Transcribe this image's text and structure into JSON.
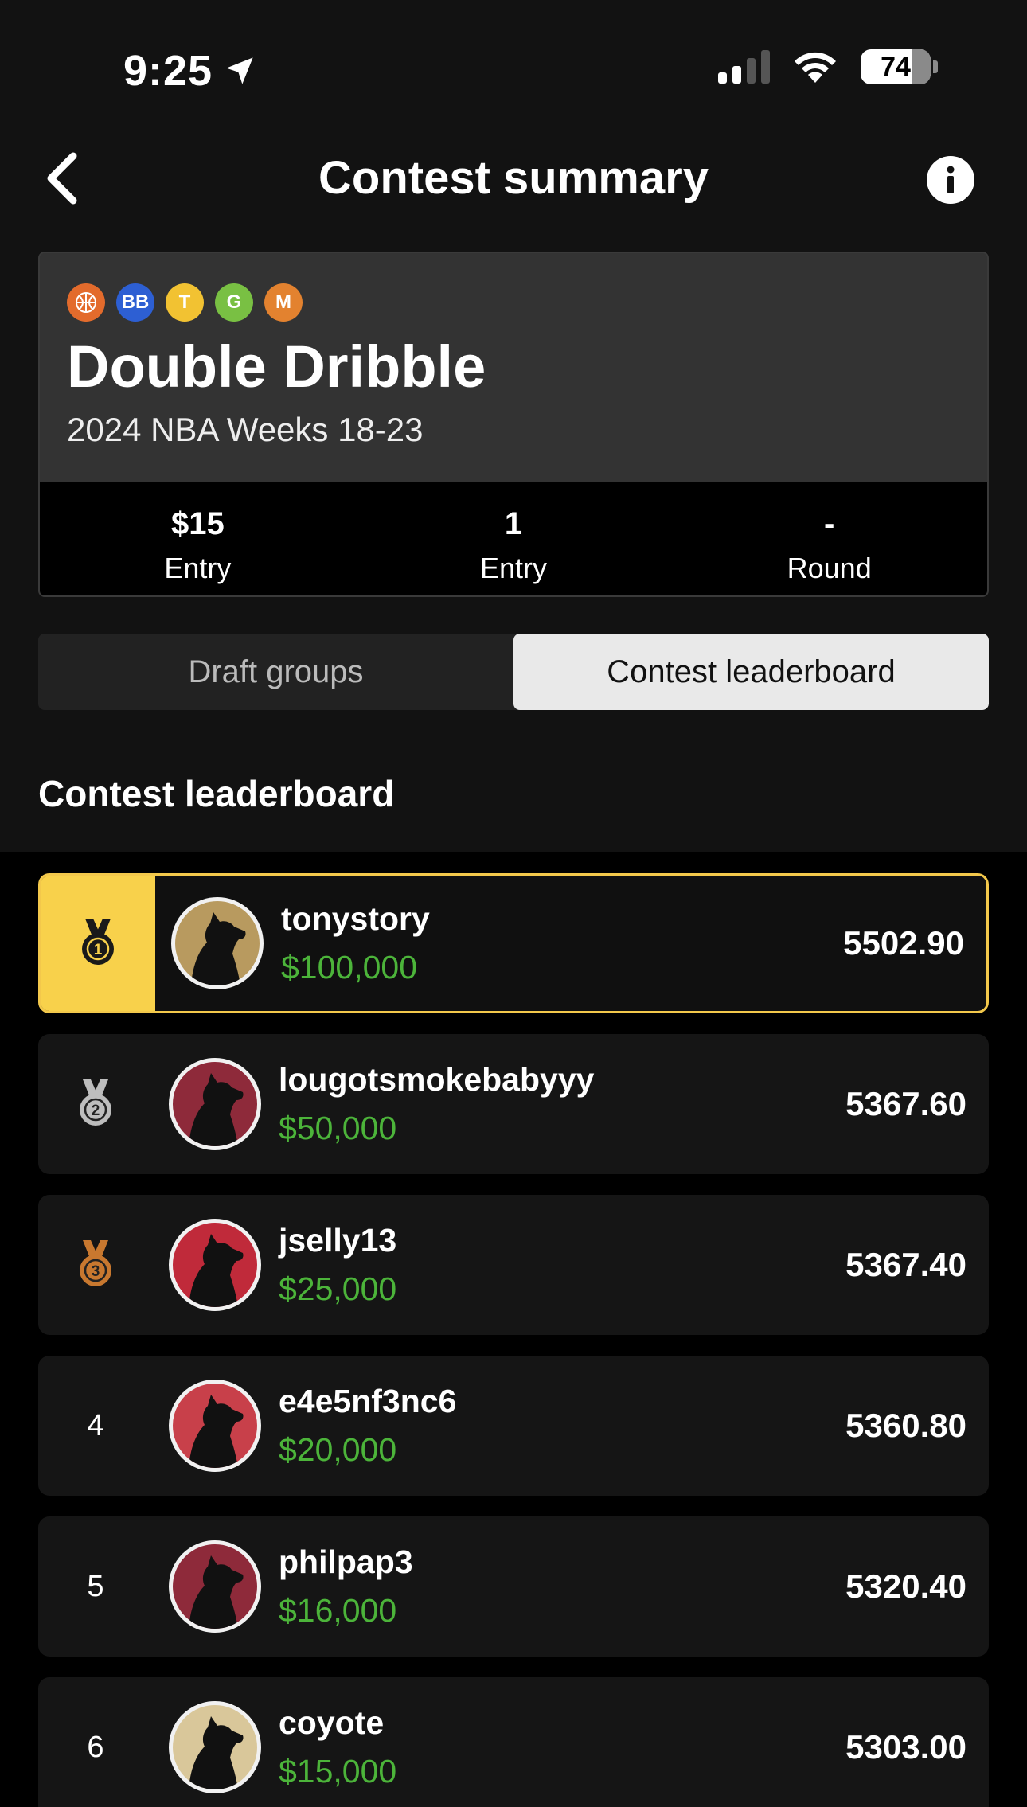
{
  "status": {
    "time": "9:25",
    "battery": "74"
  },
  "header": {
    "title": "Contest summary"
  },
  "contest": {
    "badges": [
      {
        "label": "",
        "color": "#e36b2c",
        "icon": "basketball-icon"
      },
      {
        "label": "BB",
        "color": "#2d5fd3"
      },
      {
        "label": "T",
        "color": "#f2c232"
      },
      {
        "label": "G",
        "color": "#79c043"
      },
      {
        "label": "M",
        "color": "#e3822f"
      }
    ],
    "name": "Double Dribble",
    "subtitle": "2024 NBA Weeks 18-23",
    "stats": [
      {
        "value": "$15",
        "label": "Entry"
      },
      {
        "value": "1",
        "label": "Entry"
      },
      {
        "value": "-",
        "label": "Round"
      }
    ]
  },
  "tabs": {
    "draft_groups": "Draft groups",
    "leaderboard": "Contest leaderboard",
    "active": "leaderboard"
  },
  "section_title": "Contest leaderboard",
  "leaderboard": [
    {
      "rank": "1",
      "medal": "gold-medal-icon",
      "username": "tonystory",
      "prize": "$100,000",
      "score": "5502.90",
      "avatar_bg": "#b89a5f"
    },
    {
      "rank": "2",
      "medal": "silver-medal-icon",
      "username": "lougotsmokebabyyy",
      "prize": "$50,000",
      "score": "5367.60",
      "avatar_bg": "#8e2a3a"
    },
    {
      "rank": "3",
      "medal": "bronze-medal-icon",
      "username": "jselly13",
      "prize": "$25,000",
      "score": "5367.40",
      "avatar_bg": "#c02a3a"
    },
    {
      "rank": "4",
      "medal": "",
      "username": "e4e5nf3nc6",
      "prize": "$20,000",
      "score": "5360.80",
      "avatar_bg": "#c8404a"
    },
    {
      "rank": "5",
      "medal": "",
      "username": "philpap3",
      "prize": "$16,000",
      "score": "5320.40",
      "avatar_bg": "#8e2a3a"
    },
    {
      "rank": "6",
      "medal": "",
      "username": "coyote",
      "prize": "$15,000",
      "score": "5303.00",
      "avatar_bg": "#d9c79a"
    }
  ],
  "colors": {
    "gold": "#f8d14b",
    "prize_green": "#4cb43a"
  }
}
